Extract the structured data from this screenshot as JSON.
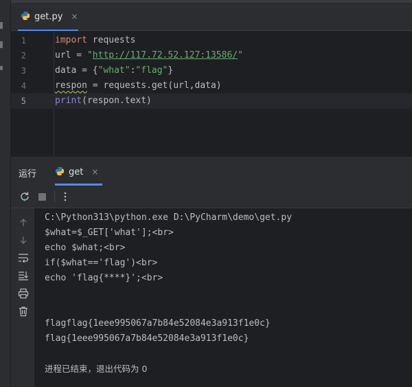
{
  "editor": {
    "tab": {
      "label": "get.py",
      "icon": "python-file-icon",
      "close": "×"
    },
    "lines": [
      {
        "number": "1",
        "tokens": [
          {
            "t": "import",
            "c": "kw"
          },
          {
            "t": " requests",
            "c": ""
          }
        ]
      },
      {
        "number": "2",
        "tokens": [
          {
            "t": "url = ",
            "c": ""
          },
          {
            "t": "\"",
            "c": "str"
          },
          {
            "t": "http://117.72.52.127:13586/",
            "c": "url"
          },
          {
            "t": "\"",
            "c": "str"
          }
        ]
      },
      {
        "number": "3",
        "tokens": [
          {
            "t": "data = {",
            "c": ""
          },
          {
            "t": "\"what\"",
            "c": "str"
          },
          {
            "t": ":",
            "c": ""
          },
          {
            "t": "\"flag\"",
            "c": "str"
          },
          {
            "t": "}",
            "c": ""
          }
        ]
      },
      {
        "number": "4",
        "tokens": [
          {
            "t": "respon",
            "c": "warn"
          },
          {
            "t": " = requests.get(url,data)",
            "c": ""
          }
        ]
      },
      {
        "number": "5",
        "tokens": [
          {
            "t": "print",
            "c": "builtin"
          },
          {
            "t": "(respon.text)",
            "c": ""
          }
        ]
      }
    ],
    "current_line": "5"
  },
  "run_panel": {
    "title": "运行",
    "tab": {
      "label": "get",
      "icon": "python-run-icon",
      "close": "×"
    },
    "toolbar": {
      "rerun_icon": "rerun-icon",
      "stop_icon": "stop-icon",
      "more_icon": "more-options-icon"
    },
    "side_tools": [
      "up-arrow-icon",
      "down-arrow-icon",
      "soft-wrap-icon",
      "scroll-to-end-icon",
      "print-icon",
      "trash-icon"
    ],
    "output": [
      "C:\\Python313\\python.exe D:\\PyCharm\\demo\\get.py",
      "$what=$_GET['what'];<br>",
      "echo $what;<br>",
      "if($what=='flag')<br>",
      "echo 'flag{****}';<br>",
      "",
      "",
      "flagflag{1eee995067a7b84e52084e3a913f1e0c}",
      "flag{1eee995067a7b84e52084e3a913f1e0c}",
      "",
      "进程已结束，退出代码为 0"
    ]
  },
  "colors": {
    "accent": "#548af7",
    "keyword": "#cf8e6d",
    "string": "#6aab73",
    "builtin": "#8888c6"
  }
}
